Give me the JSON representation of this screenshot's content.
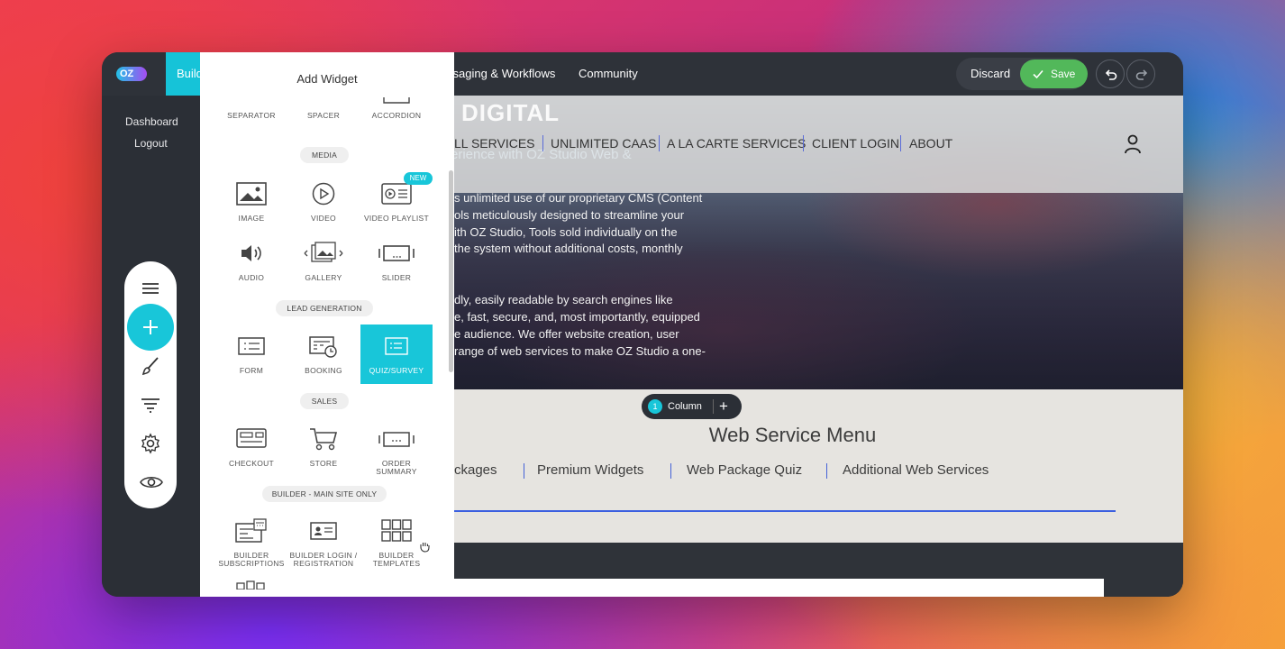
{
  "topbar": {
    "logo_text": "OZ",
    "builder_tab": "Builder",
    "nav": [
      "ssaging & Workflows",
      "Community"
    ],
    "discard_label": "Discard",
    "save_label": "Save"
  },
  "sidebar": {
    "links": [
      "Dashboard",
      "Logout"
    ]
  },
  "panel": {
    "title": "Add Widget",
    "new_badge": "NEW",
    "sections": {
      "media": "MEDIA",
      "lead": "LEAD GENERATION",
      "sales": "SALES",
      "builder": "BUILDER - MAIN SITE ONLY"
    },
    "widgets": {
      "separator": "SEPARATOR",
      "spacer": "SPACER",
      "accordion": "ACCORDION",
      "image": "IMAGE",
      "video": "VIDEO",
      "video_playlist": "VIDEO PLAYLIST",
      "audio": "AUDIO",
      "gallery": "GALLERY",
      "slider": "SLIDER",
      "form": "FORM",
      "booking": "BOOKING",
      "quiz": "QUIZ/SURVEY",
      "checkout": "CHECKOUT",
      "store": "STORE",
      "order_summary": "ORDER SUMMARY",
      "builder_subs_1": "BUILDER",
      "builder_subs_2": "SUBSCRIPTIONS",
      "builder_login_1": "BUILDER LOGIN /",
      "builder_login_2": "REGISTRATION",
      "builder_templates_1": "BUILDER",
      "builder_templates_2": "TEMPLATES"
    }
  },
  "preview": {
    "brand": "DIGITAL",
    "nav": [
      "LL SERVICES",
      "UNLIMITED CAAS",
      "A LA CARTE SERVICES",
      "CLIENT LOGIN",
      "ABOUT"
    ],
    "tagline": "erience with OZ Studio Web &",
    "paragraph1": [
      "s unlimited use of our proprietary CMS (Content",
      "ols meticulously designed to streamline your",
      "ith OZ Studio, Tools sold individually on the",
      "the system without additional costs, monthly"
    ],
    "paragraph2": [
      "dly, easily readable by search engines like",
      "e, fast, secure, and, most importantly, equipped",
      "e audience. We offer website creation, user",
      "range of web services to make OZ Studio a one-"
    ],
    "column_chip": {
      "number": "1",
      "label": "Column",
      "plus": "+"
    },
    "menu_title": "Web Service Menu",
    "menu_links": [
      "ckages",
      "Premium Widgets",
      "Web Package Quiz",
      "Additional Web Services"
    ]
  }
}
